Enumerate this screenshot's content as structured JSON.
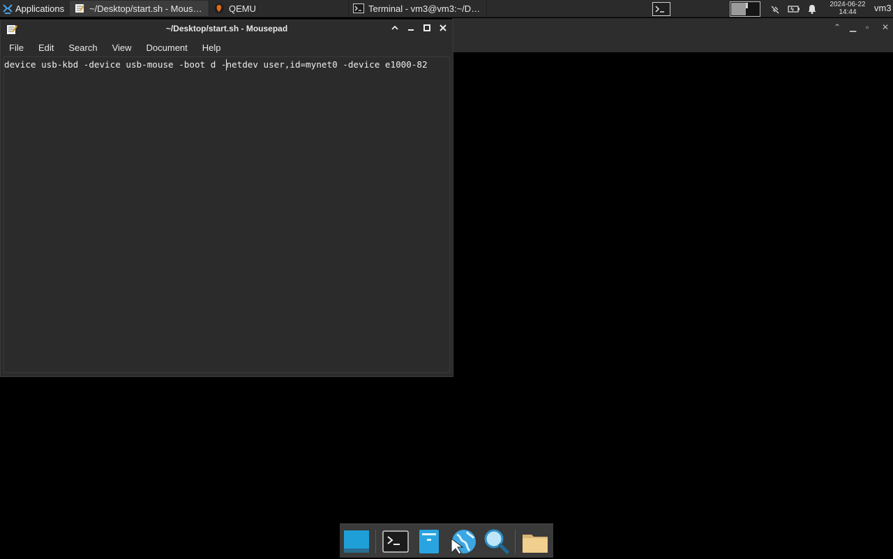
{
  "panel": {
    "applications_label": "Applications",
    "tasks": [
      {
        "label": "~/Desktop/start.sh - Mous…",
        "icon": "text-editor-icon"
      },
      {
        "label": "QEMU",
        "icon": "qemu-icon"
      },
      {
        "label": "Terminal - vm3@vm3:~/D…",
        "icon": "terminal-icon"
      }
    ],
    "clock_date": "2024-06-22",
    "clock_time": "14:44",
    "user": "vm3"
  },
  "window": {
    "title": "~/Desktop/start.sh - Mousepad",
    "menus": [
      "File",
      "Edit",
      "Search",
      "View",
      "Document",
      "Help"
    ],
    "text_line": "device usb-kbd -device usb-mouse -boot d -netdev user,id=mynet0 -device e1000-82"
  },
  "dock": {
    "items": [
      "desktop-icon",
      "terminal-icon",
      "file-manager-icon",
      "web-browser-icon",
      "search-icon",
      "folder-icon"
    ]
  },
  "colors": {
    "panel_bg": "#2b2b2b",
    "window_bg": "#2c2c2c",
    "desktop_bg": "#000000",
    "dock_bg": "#3a3a3a"
  }
}
